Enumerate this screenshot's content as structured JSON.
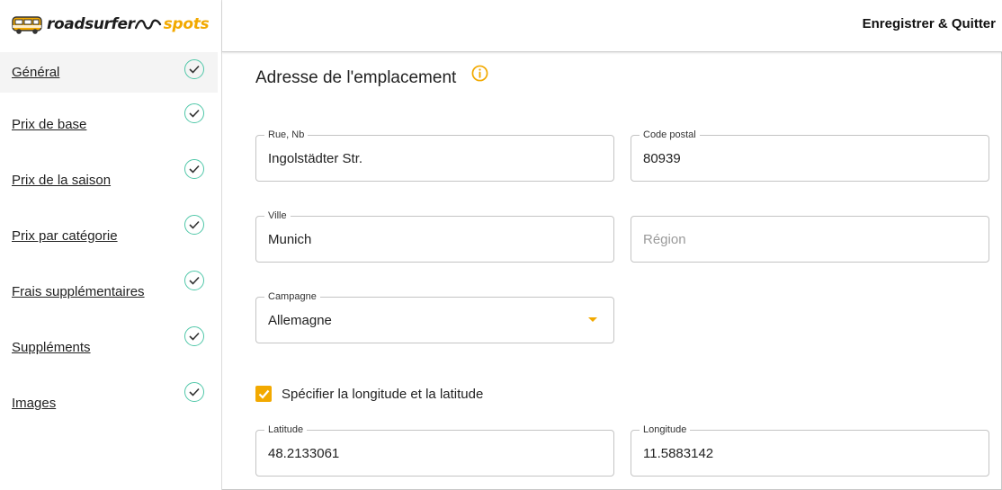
{
  "app": {
    "logo_text": "roadsurfer",
    "logo_suffix": "spots",
    "brand_color": "#f2a900",
    "check_color": "#4fc7a8"
  },
  "header": {
    "save_label": "Enregistrer & Quitter"
  },
  "sidebar": {
    "items": [
      {
        "label": "Général",
        "completed": true,
        "active": true
      },
      {
        "label": "Prix de base",
        "completed": true,
        "active": false
      },
      {
        "label": "Prix de la saison",
        "completed": true,
        "active": false
      },
      {
        "label": "Prix par catégorie",
        "completed": true,
        "active": false
      },
      {
        "label": "Frais supplémentaires",
        "completed": true,
        "active": false
      },
      {
        "label": "Suppléments",
        "completed": true,
        "active": false
      },
      {
        "label": "Images",
        "completed": true,
        "active": false
      }
    ]
  },
  "main": {
    "section_title": "Adresse de l'emplacement",
    "info_icon": "info-circle-icon",
    "fields": {
      "street": {
        "label": "Rue, Nb",
        "value": "Ingolstädter Str."
      },
      "postal_code": {
        "label": "Code postal",
        "value": "80939"
      },
      "city": {
        "label": "Ville",
        "value": "Munich"
      },
      "region": {
        "label": "",
        "value": "",
        "placeholder": "Région"
      },
      "country": {
        "label": "Campagne",
        "value": "Allemagne"
      },
      "latitude": {
        "label": "Latitude",
        "value": "48.2133061"
      },
      "longitude": {
        "label": "Longitude",
        "value": "11.5883142"
      }
    },
    "coords_checkbox": {
      "label": "Spécifier la longitude et la latitude",
      "checked": true
    }
  }
}
